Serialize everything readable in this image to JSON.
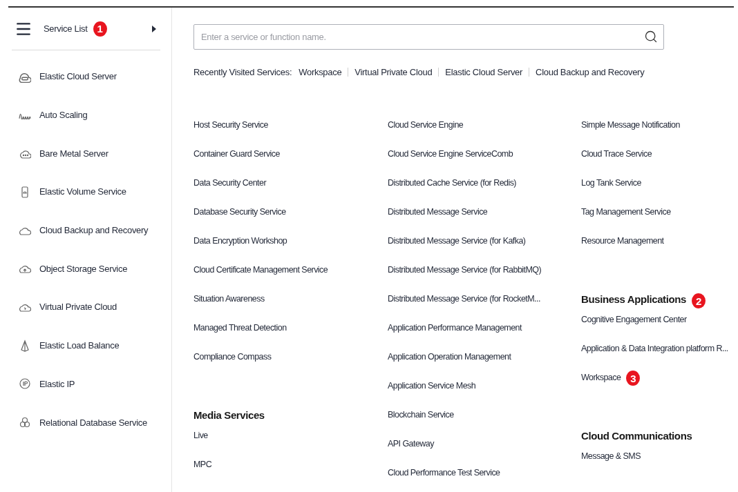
{
  "sidebar": {
    "header": {
      "title": "Service List",
      "badge": "1"
    },
    "items": [
      {
        "label": "Elastic Cloud Server"
      },
      {
        "label": "Auto Scaling"
      },
      {
        "label": "Bare Metal Server"
      },
      {
        "label": "Elastic Volume Service"
      },
      {
        "label": "Cloud Backup and Recovery"
      },
      {
        "label": "Object Storage Service"
      },
      {
        "label": "Virtual Private Cloud"
      },
      {
        "label": "Elastic Load Balance"
      },
      {
        "label": "Elastic IP"
      },
      {
        "label": "Relational Database Service"
      }
    ]
  },
  "search": {
    "placeholder": "Enter a service or function name."
  },
  "recent": {
    "label": "Recently Visited Services:",
    "links": [
      "Workspace",
      "Virtual Private Cloud",
      "Elastic Cloud Server",
      "Cloud Backup and Recovery"
    ]
  },
  "columns": [
    [
      {
        "items": [
          {
            "label": "Host Security Service"
          },
          {
            "label": "Container Guard Service"
          },
          {
            "label": "Data Security Center"
          },
          {
            "label": "Database Security Service"
          },
          {
            "label": "Data Encryption Workshop"
          },
          {
            "label": "Cloud Certificate Management Service"
          },
          {
            "label": "Situation Awareness"
          },
          {
            "label": "Managed Threat Detection"
          },
          {
            "label": "Compliance Compass"
          }
        ]
      },
      {
        "heading": "Media Services",
        "items": [
          {
            "label": "Live"
          },
          {
            "label": "MPC"
          }
        ]
      }
    ],
    [
      {
        "items": [
          {
            "label": "Cloud Service Engine"
          },
          {
            "label": "Cloud Service Engine ServiceComb"
          },
          {
            "label": "Distributed Cache Service (for Redis)"
          },
          {
            "label": "Distributed Message Service"
          },
          {
            "label": "Distributed Message Service (for Kafka)"
          },
          {
            "label": "Distributed Message Service (for RabbitMQ)"
          },
          {
            "label": "Distributed Message Service (for RocketM..."
          },
          {
            "label": "Application Performance Management"
          },
          {
            "label": "Application Operation Management"
          },
          {
            "label": "Application Service Mesh"
          },
          {
            "label": "Blockchain Service"
          },
          {
            "label": "API Gateway"
          },
          {
            "label": "Cloud Performance Test Service"
          }
        ]
      }
    ],
    [
      {
        "items": [
          {
            "label": "Simple Message Notification"
          },
          {
            "label": "Cloud Trace Service"
          },
          {
            "label": "Log Tank Service"
          },
          {
            "label": "Tag Management Service"
          },
          {
            "label": "Resource Management"
          }
        ]
      },
      {
        "heading": "Business Applications",
        "badge": "2",
        "items": [
          {
            "label": "Cognitive Engagement Center"
          },
          {
            "label": "Application & Data Integration platform R..."
          },
          {
            "label": "Workspace",
            "badge": "3"
          }
        ]
      },
      {
        "heading": "Cloud Communications",
        "items": [
          {
            "label": "Message & SMS"
          }
        ]
      }
    ]
  ]
}
